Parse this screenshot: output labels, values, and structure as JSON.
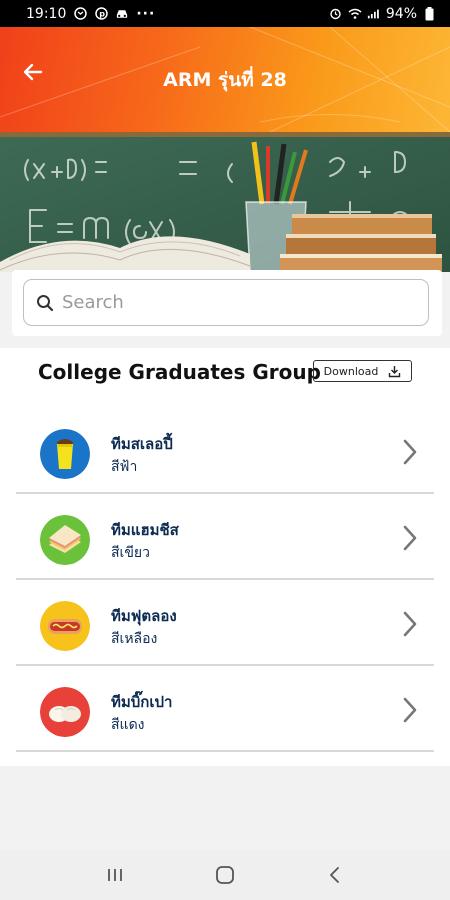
{
  "status_bar": {
    "time": "19:10",
    "battery": "94%",
    "left_icons": [
      "gmail-icon",
      "pinterest-icon",
      "car-icon",
      "more-dots-icon"
    ],
    "right_icons": [
      "alarm-icon",
      "wifi-icon",
      "signal-icon",
      "battery-icon"
    ]
  },
  "header": {
    "title": "ARM รุ่นที่ 28",
    "back_icon": "arrow-left-icon",
    "gradient": [
      "#f0401a",
      "#fdb735"
    ]
  },
  "search": {
    "placeholder": "Search",
    "value": ""
  },
  "group": {
    "title": "College Graduates Group",
    "download_label": "Download"
  },
  "teams": [
    {
      "name": "ทีมสเลอปี้",
      "color_label": "สีฟ้า",
      "icon": "slurpee-cup-icon",
      "circle_color": "#1a75c9"
    },
    {
      "name": "ทีมแฮมชีส",
      "color_label": "สีเขียว",
      "icon": "ham-cheese-sandwich-icon",
      "circle_color": "#6cc13b"
    },
    {
      "name": "ทีมฟุตลอง",
      "color_label": "สีเหลือง",
      "icon": "footlong-hotdog-icon",
      "circle_color": "#f7c21b"
    },
    {
      "name": "ทีมบิ๊กเปา",
      "color_label": "สีแดง",
      "icon": "bao-bun-icon",
      "circle_color": "#e8413a"
    }
  ],
  "navbar": {
    "icons": [
      "recent-apps-icon",
      "home-icon",
      "back-icon"
    ]
  }
}
